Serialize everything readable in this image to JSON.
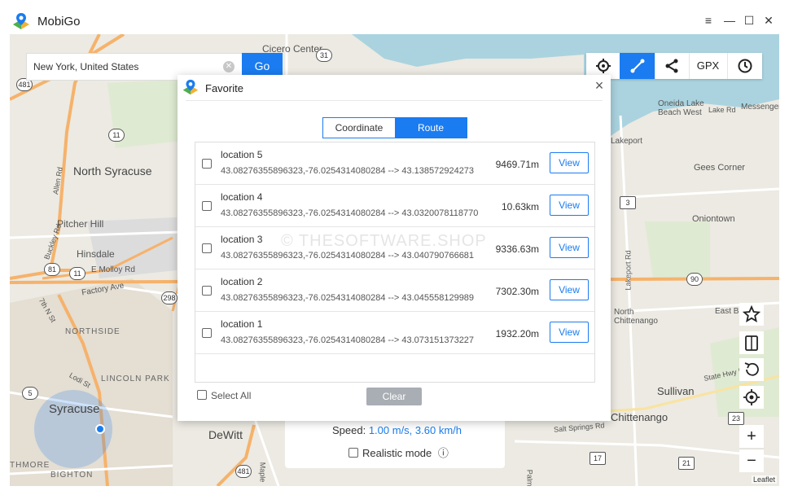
{
  "app": {
    "title": "MobiGo"
  },
  "window": {
    "menu_icon": "≡",
    "minimize_icon": "—",
    "maximize_icon": "☐",
    "close_icon": "✕"
  },
  "search": {
    "value": "New York, United States",
    "go_label": "Go"
  },
  "toolbar": {
    "gpx_label": "GPX",
    "active_tool": "multi-spot-route"
  },
  "map": {
    "labels": [
      "Cicero Center",
      "North Syracuse",
      "Pitcher Hill",
      "Hinsdale",
      "E Molloy Rd",
      "Factory Ave",
      "NORTHSIDE",
      "LINCOLN PARK",
      "Syracuse",
      "BIGHTON",
      "DeWitt",
      "Lakeport",
      "Gees Corner",
      "Oniontown",
      "Oneida Lake Beach West",
      "Lake Rd",
      "Messenger",
      "North Chittenango",
      "East Bo",
      "Sullivan",
      "Chittenango",
      "State Hwy 5",
      "Salt Springs Rd",
      "Lakeport Rd",
      "Allen Rd",
      "Buckley Rd",
      "7th N St",
      "Lodi St",
      "Maple",
      "Palm",
      "THMORE"
    ],
    "shields": [
      "481",
      "31",
      "11",
      "298",
      "3",
      "90",
      "23",
      "17",
      "21",
      "5",
      "81",
      "481",
      "11"
    ],
    "attribution": "Leaflet",
    "accent": "#1a7cf0"
  },
  "speed_panel": {
    "label": "Speed:",
    "value": "1.00 m/s, 3.60 km/h",
    "realistic_label": "Realistic mode",
    "info_icon": "ⓘ"
  },
  "dialog": {
    "title": "Favorite",
    "tabs": [
      {
        "label": "Coordinate"
      },
      {
        "label": "Route"
      }
    ],
    "active_tab": "Route",
    "rows": [
      {
        "name": "location 5",
        "coords": "43.08276355896323,-76.0254314080284 --> 43.138572924273",
        "distance": "9469.71m",
        "view": "View"
      },
      {
        "name": "location 4",
        "coords": "43.08276355896323,-76.0254314080284 --> 43.0320078118770",
        "distance": "10.63km",
        "view": "View"
      },
      {
        "name": "location 3",
        "coords": "43.08276355896323,-76.0254314080284 --> 43.040790766681",
        "distance": "9336.63m",
        "view": "View"
      },
      {
        "name": "location 2",
        "coords": "43.08276355896323,-76.0254314080284 --> 43.045558129989",
        "distance": "7302.30m",
        "view": "View"
      },
      {
        "name": "location 1",
        "coords": "43.08276355896323,-76.0254314080284 --> 43.073151373227",
        "distance": "1932.20m",
        "view": "View"
      }
    ],
    "select_all": "Select All",
    "clear": "Clear",
    "watermark": "© THESOFTWARE.SHOP"
  }
}
